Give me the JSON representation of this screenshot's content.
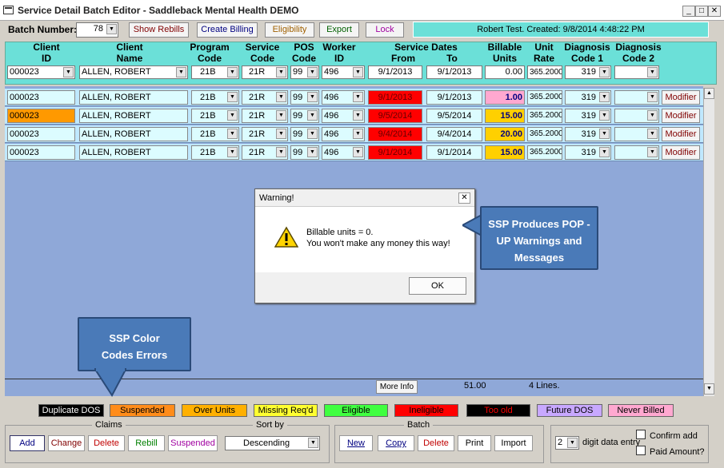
{
  "window": {
    "title": "Service Detail Batch Editor - Saddleback Mental Health DEMO"
  },
  "toolbar": {
    "batch_label": "Batch Number:",
    "batch_value": "78",
    "show_rebills": "Show Rebills",
    "create_billing": "Create Billing",
    "eligibility": "Eligibility",
    "export": "Export",
    "lock": "Lock",
    "status": "Robert Test. Created: 9/8/2014 4:48:22 PM"
  },
  "headers": {
    "client_id": [
      "Client",
      "ID"
    ],
    "client_name": [
      "Client",
      "Name"
    ],
    "program_code": [
      "Program",
      "Code"
    ],
    "service_code": [
      "Service",
      "Code"
    ],
    "pos_code": [
      "POS",
      "Code"
    ],
    "worker_id": [
      "Worker",
      "ID"
    ],
    "service_dates": "Service Dates",
    "from": "From",
    "to": "To",
    "billable_units": [
      "Billable",
      "Units"
    ],
    "unit_rate": [
      "Unit",
      "Rate"
    ],
    "diag1": [
      "Diagnosis",
      "Code 1"
    ],
    "diag2": [
      "Diagnosis",
      "Code 2"
    ]
  },
  "entry": {
    "client_id": "000023",
    "client_name": "ALLEN, ROBERT",
    "program": "21B",
    "service": "21R",
    "pos": "99",
    "worker": "496",
    "from": "9/1/2013",
    "to": "9/1/2013",
    "units": "0.00",
    "rate": "365.2000",
    "diag1": "319",
    "diag2": ""
  },
  "rows": [
    {
      "client_id": "000023",
      "client_name": "ALLEN, ROBERT",
      "program": "21B",
      "service": "21R",
      "pos": "99",
      "worker": "496",
      "from": "9/1/2013",
      "to": "9/1/2013",
      "units": "1.00",
      "rate": "365.2000",
      "diag1": "319",
      "modifier": "Modifier",
      "id_color": "#dcfcff",
      "from_color": "#ff0000",
      "units_color": "#ffa8d0"
    },
    {
      "client_id": "000023",
      "client_name": "ALLEN, ROBERT",
      "program": "21B",
      "service": "21R",
      "pos": "99",
      "worker": "496",
      "from": "9/5/2014",
      "to": "9/5/2014",
      "units": "15.00",
      "rate": "365.2000",
      "diag1": "319",
      "modifier": "Modifier",
      "id_color": "#ff9900",
      "from_color": "#ff0000",
      "units_color": "#ffd000"
    },
    {
      "client_id": "000023",
      "client_name": "ALLEN, ROBERT",
      "program": "21B",
      "service": "21R",
      "pos": "99",
      "worker": "496",
      "from": "9/4/2014",
      "to": "9/4/2014",
      "units": "20.00",
      "rate": "365.2000",
      "diag1": "319",
      "modifier": "Modifier",
      "id_color": "#dcfcff",
      "from_color": "#ff0000",
      "units_color": "#ffd000"
    },
    {
      "client_id": "000023",
      "client_name": "ALLEN, ROBERT",
      "program": "21B",
      "service": "21R",
      "pos": "99",
      "worker": "496",
      "from": "9/1/2014",
      "to": "9/1/2014",
      "units": "15.00",
      "rate": "365.2000",
      "diag1": "319",
      "modifier": "Modifier",
      "id_color": "#dcfcff",
      "from_color": "#ff0000",
      "units_color": "#ffd000"
    }
  ],
  "footer": {
    "more_info": "More Info",
    "total": "51.00",
    "lines": "4 Lines."
  },
  "legend": [
    {
      "label": "Duplicate DOS",
      "bg": "#000000",
      "fg": "#ffffff"
    },
    {
      "label": "Suspended",
      "bg": "#ff8c1a",
      "fg": "#000000"
    },
    {
      "label": "Over Units",
      "bg": "#ffb000",
      "fg": "#000000"
    },
    {
      "label": "Missing Req'd",
      "bg": "#ffff30",
      "fg": "#000000"
    },
    {
      "label": "Eligible",
      "bg": "#40ff40",
      "fg": "#000000"
    },
    {
      "label": "Ineligible",
      "bg": "#ff0000",
      "fg": "#000000"
    },
    {
      "label": "Too old",
      "bg": "#000000",
      "fg": "#ff0000"
    },
    {
      "label": "Future DOS",
      "bg": "#c8a8ff",
      "fg": "#000000"
    },
    {
      "label": "Never Billed",
      "bg": "#ffa8d0",
      "fg": "#000000"
    }
  ],
  "claims": {
    "title": "Claims",
    "add": "Add",
    "change": "Change",
    "delete": "Delete",
    "rebill": "Rebill",
    "suspended": "Suspended"
  },
  "sort": {
    "title": "Sort by",
    "value": "Descending"
  },
  "batch": {
    "title": "Batch",
    "new": "New",
    "copy": "Copy",
    "delete": "Delete",
    "print": "Print",
    "import": "Import"
  },
  "options": {
    "digit_value": "2",
    "digit_label": "digit data entry",
    "confirm_add": "Confirm add",
    "paid_amount": "Paid Amount?"
  },
  "dialog": {
    "title": "Warning!",
    "line1": "Billable units = 0.",
    "line2": "You won't make any money this way!",
    "ok": "OK"
  },
  "callouts": {
    "popup": "SSP Produces POP - UP Warnings and Messages",
    "colors": "SSP Color Codes Errors"
  }
}
